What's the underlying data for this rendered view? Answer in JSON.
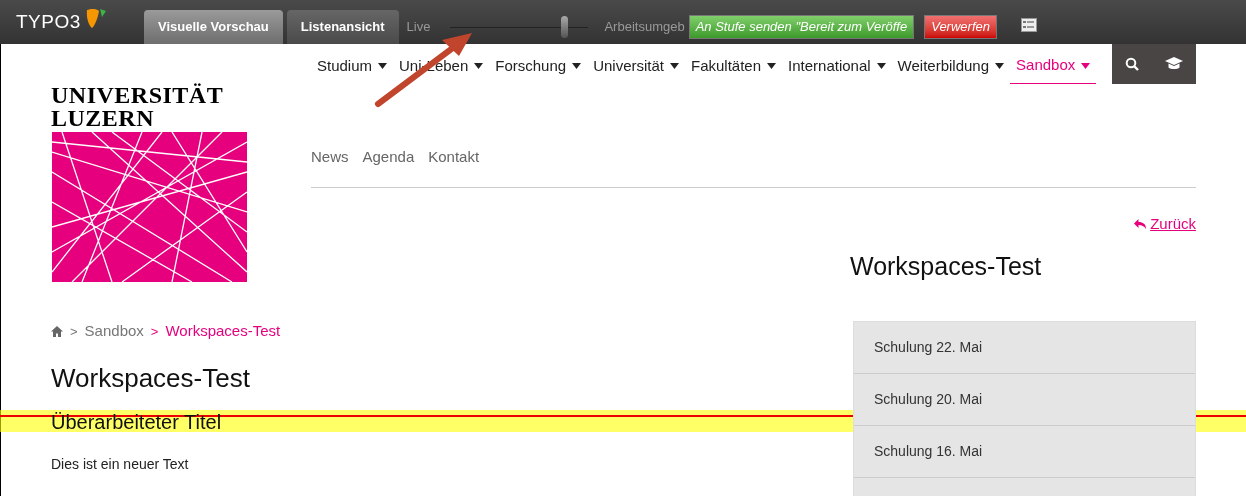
{
  "toolbar": {
    "logo": "TYPO3",
    "tabs": [
      {
        "label": "Visuelle Vorschau",
        "selected": true
      },
      {
        "label": "Listenansicht",
        "selected": false
      }
    ],
    "slider": {
      "left_label": "Live",
      "level": 0.82,
      "right_label": "Arbeitsumgeb"
    },
    "send_button": "An Stufe senden \"Bereit zum Veröffe",
    "discard_button": "Verwerfen"
  },
  "site": {
    "logo_lines": [
      "UNIVERSITÄT",
      "LUZERN"
    ],
    "nav": [
      {
        "label": "Studium",
        "selected": false
      },
      {
        "label": "Uni-Leben",
        "selected": false
      },
      {
        "label": "Forschung",
        "selected": false
      },
      {
        "label": "Universität",
        "selected": false
      },
      {
        "label": "Fakultäten",
        "selected": false
      },
      {
        "label": "International",
        "selected": false
      },
      {
        "label": "Weiterbildung",
        "selected": false
      },
      {
        "label": "Sandbox",
        "selected": true
      }
    ],
    "subnav": [
      "News",
      "Agenda",
      "Kontakt"
    ],
    "back_link": "Zurück",
    "breadcrumb": [
      {
        "separator": ">",
        "label": "Sandbox",
        "current": false
      },
      {
        "separator": ">",
        "label": "Workspaces-Test",
        "current": true
      }
    ],
    "title": "Workspaces-Test",
    "subheading": {
      "text": "Überarbeiteter Titel",
      "changed": true
    },
    "body": "Dies ist ein neuer Text",
    "sidebar": {
      "title": "Workspaces-Test",
      "items": [
        "Schulung 22. Mai",
        "Schulung 20. Mai",
        "Schulung 16. Mai"
      ]
    }
  }
}
